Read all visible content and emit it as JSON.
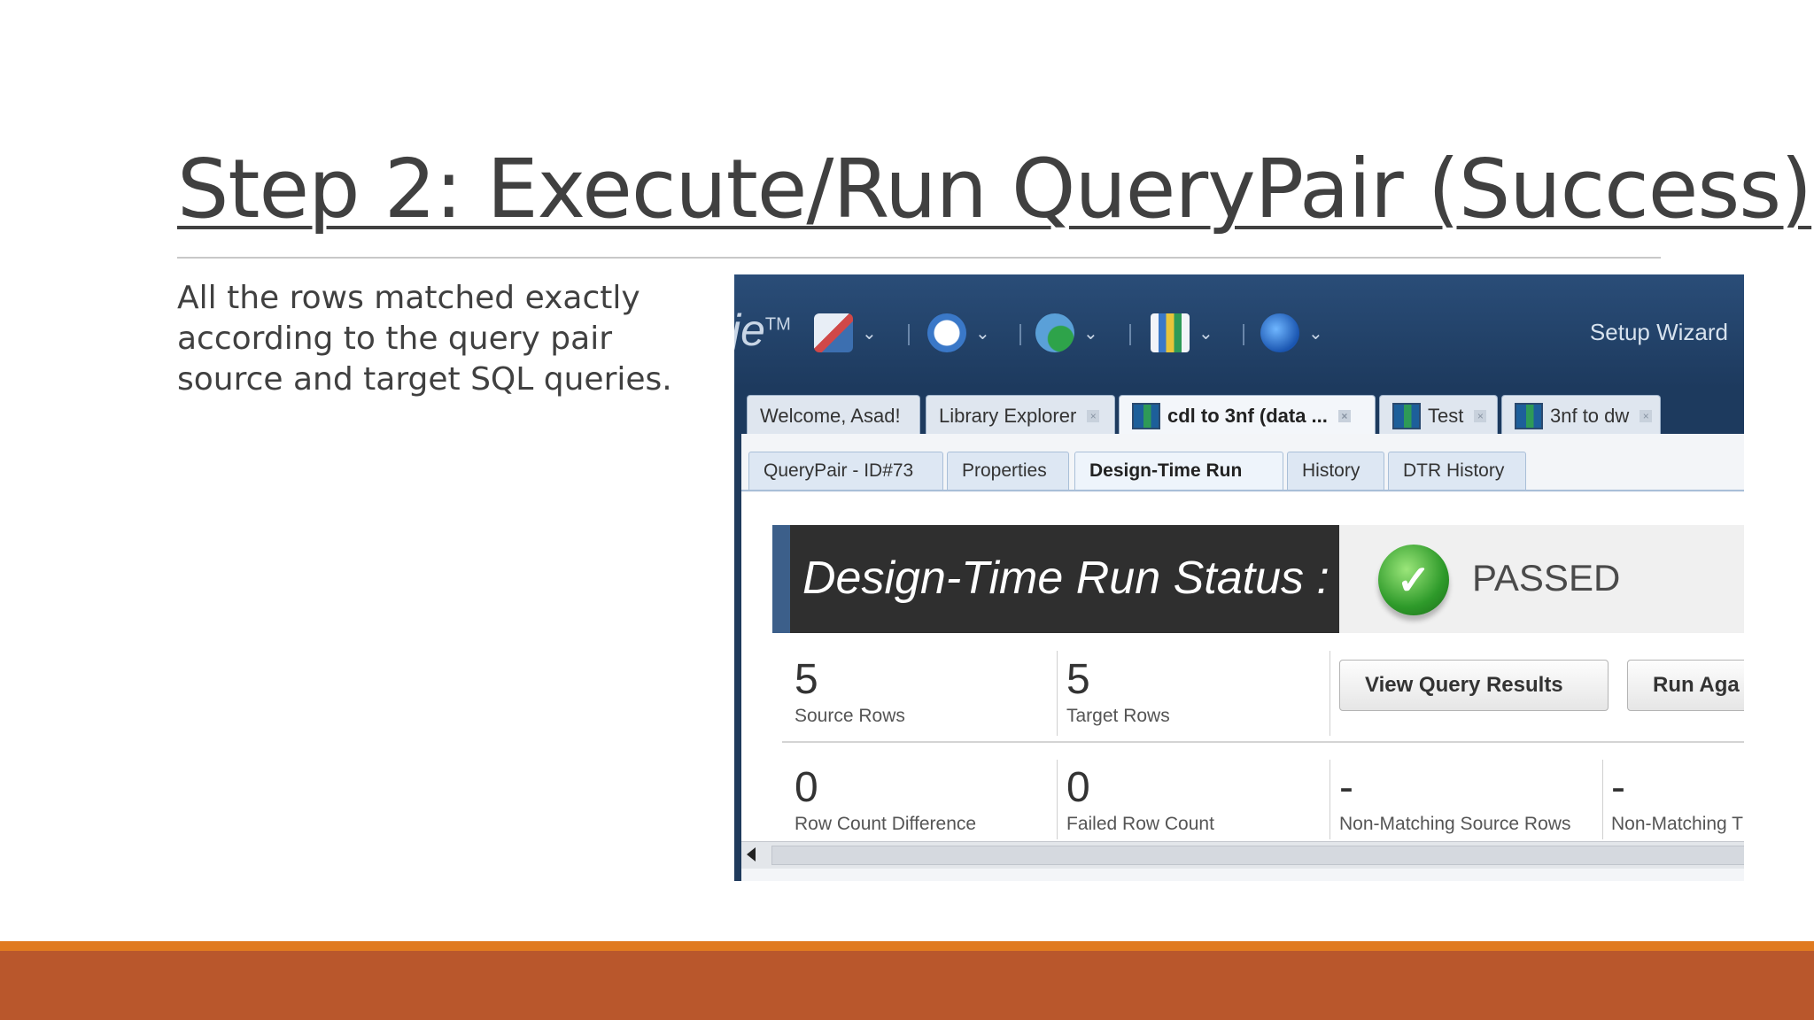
{
  "slide": {
    "title": "Step 2: Execute/Run QueryPair (Success)",
    "body": "All the rows matched exactly according to the query pair source and target SQL queries."
  },
  "app": {
    "logo_fragment": "je",
    "logo_tm": "TM",
    "toolbar": {
      "setup_wizard": "Setup Wizard",
      "icons": [
        "design-icon",
        "clock-icon",
        "run-gear-icon",
        "report-icon",
        "tools-icon"
      ]
    },
    "doc_tabs": [
      {
        "label": "Welcome, Asad!",
        "has_icon": false,
        "closable": false
      },
      {
        "label": "Library Explorer",
        "has_icon": false,
        "closable": true
      },
      {
        "label": "cdl to 3nf (data ...",
        "has_icon": true,
        "closable": true,
        "active": true
      },
      {
        "label": "Test",
        "has_icon": true,
        "closable": true
      },
      {
        "label": "3nf to dw",
        "has_icon": true,
        "closable": true
      }
    ],
    "sub_tabs": [
      {
        "label": "QueryPair - ID#73"
      },
      {
        "label": "Properties"
      },
      {
        "label": "Design-Time Run",
        "active": true
      },
      {
        "label": "History"
      },
      {
        "label": "DTR History"
      }
    ],
    "status": {
      "heading": "Design-Time Run Status :",
      "result": "PASSED",
      "result_color": "#2e9a2a"
    },
    "metrics_row1": [
      {
        "value": "5",
        "label": "Source Rows"
      },
      {
        "value": "5",
        "label": "Target Rows"
      }
    ],
    "buttons": {
      "view_results": "View Query Results",
      "run_again": "Run Aga"
    },
    "metrics_row2": [
      {
        "value": "0",
        "label": "Row Count Difference"
      },
      {
        "value": "0",
        "label": "Failed Row Count"
      },
      {
        "value": "-",
        "label": "Non-Matching Source Rows"
      },
      {
        "value": "-",
        "label": "Non-Matching T"
      }
    ]
  },
  "colors": {
    "footer_orange": "#e07a20",
    "footer_red": "#b9572c",
    "app_chrome": "#1f3a5c"
  }
}
